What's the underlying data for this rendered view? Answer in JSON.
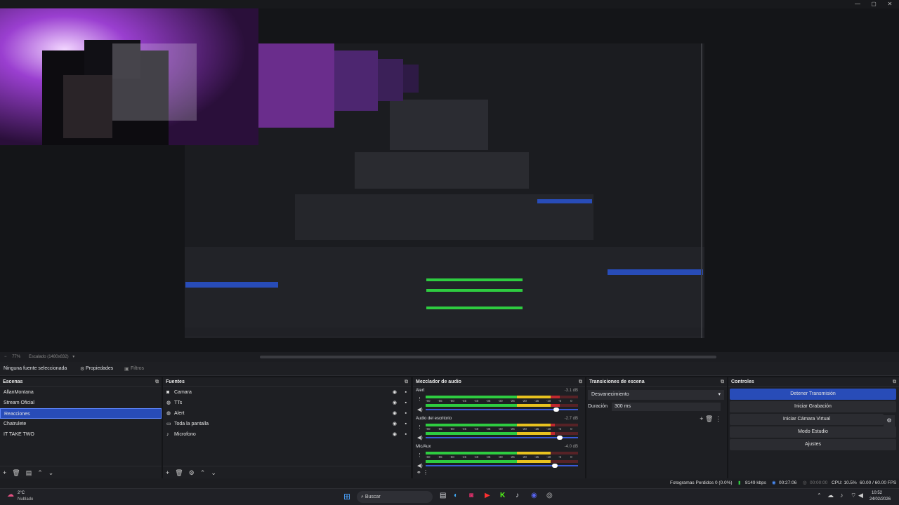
{
  "window": {
    "min": "—",
    "max": "▢",
    "close": "✕"
  },
  "preview": {
    "zoom": "77%",
    "scaling": "Escalado (1480x832)"
  },
  "srcbar": {
    "none_selected": "Ninguna fuente seleccionada",
    "properties": "Propiedades",
    "filters": "Filtros"
  },
  "scenes": {
    "title": "Escenas",
    "items": [
      "AllanMontana",
      "Stream Oficial",
      "Reacciones",
      "Chatrulete",
      "IT TAKE TWO"
    ],
    "selected": 2
  },
  "sources": {
    "title": "Fuentes",
    "items": [
      {
        "label": "Camara",
        "icon": "camera-icon"
      },
      {
        "label": "TTs",
        "icon": "browser-icon"
      },
      {
        "label": "Alert",
        "icon": "browser-icon"
      },
      {
        "label": "Toda la pantalla",
        "icon": "monitor-icon"
      },
      {
        "label": "Microfono",
        "icon": "mic-icon"
      }
    ]
  },
  "mixer": {
    "title": "Mezclador de audio",
    "channels": [
      {
        "name": "Alert",
        "db": "-3.1 dB",
        "level": 0.88,
        "volume": 0.84
      },
      {
        "name": "Audio del escritorio",
        "db": "-2.7 dB",
        "level": 0.85,
        "volume": 0.86
      },
      {
        "name": "Mic/Aux",
        "db": "-4.0 dB",
        "level": 0.82,
        "volume": 0.83
      }
    ],
    "ticks": [
      "-60",
      "-55",
      "-50",
      "-45",
      "-40",
      "-35",
      "-30",
      "-25",
      "-20",
      "-15",
      "-10",
      "-5",
      "0"
    ]
  },
  "transitions": {
    "title": "Transiciones de escena",
    "selected": "Desvanecimiento",
    "duration_label": "Duración",
    "duration_value": "300 ms"
  },
  "controls": {
    "title": "Controles",
    "stop_stream": "Detener Transmisión",
    "start_rec": "Iniciar Grabación",
    "virtual_cam": "Iniciar Cámara Virtual",
    "studio_mode": "Modo Estudio",
    "settings": "Ajustes"
  },
  "status": {
    "dropped": "Fotogramas Perdidos 0 (0.0%)",
    "bitrate": "8149 kbps",
    "stream_time": "00:27:06",
    "rec_time": "00:00:00",
    "cpu": "CPU: 10.5%",
    "fps": "60.00 / 60.00 FPS"
  },
  "taskbar": {
    "weather_temp": "2°C",
    "weather_desc": "Nublado",
    "search": "Buscar",
    "time": "10:52",
    "date": "24/02/2026"
  },
  "colors": {
    "accent": "#284cb8",
    "meter_green": "#2ecc40",
    "meter_yellow": "#e8c21f",
    "meter_red": "#c0282e"
  }
}
